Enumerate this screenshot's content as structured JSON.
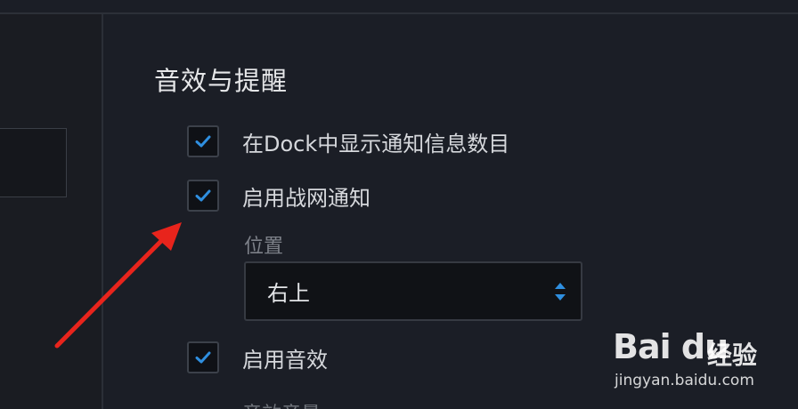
{
  "section": {
    "title": "音效与提醒"
  },
  "options": {
    "dock_badge": {
      "label": "在Dock中显示通知信息数目",
      "checked": true
    },
    "battlenet_notify": {
      "label": "启用战网通知",
      "checked": true
    },
    "sound": {
      "label": "启用音效",
      "checked": true
    }
  },
  "position": {
    "label": "位置",
    "value": "右上"
  },
  "partial_next_label": "音效音量",
  "watermark": {
    "logo": "Bai du",
    "brand_cn": "经验",
    "url": "jingyan.baidu.com"
  },
  "colors": {
    "background": "#1b1e26",
    "checkmark": "#2f8fe0",
    "annotation_arrow": "#e8241c"
  },
  "icons": {
    "checkbox": "check-icon",
    "select": "updown-chevron-icon",
    "annotation": "red-arrow-icon"
  }
}
